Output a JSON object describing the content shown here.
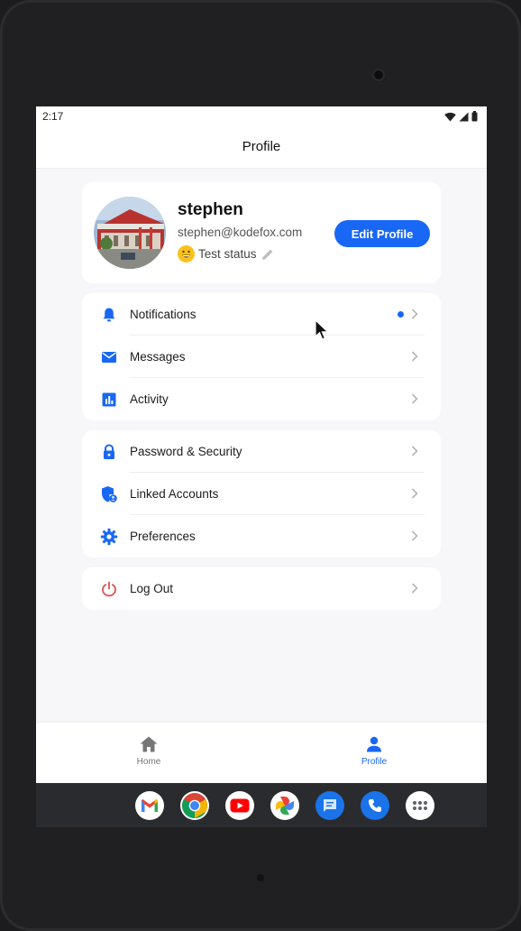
{
  "status_bar": {
    "time": "2:17"
  },
  "app_bar": {
    "title": "Profile"
  },
  "profile": {
    "username": "stephen",
    "email": "stephen@kodefox.com",
    "status_emoji": "grinning-face-icon",
    "status_text": "Test status",
    "edit_button_label": "Edit Profile"
  },
  "menu_groups": [
    {
      "items": [
        {
          "label": "Notifications",
          "icon": "bell-icon",
          "has_dot": true
        },
        {
          "label": "Messages",
          "icon": "mail-icon"
        },
        {
          "label": "Activity",
          "icon": "bar-chart-icon"
        }
      ]
    },
    {
      "items": [
        {
          "label": "Password & Security",
          "icon": "lock-icon"
        },
        {
          "label": "Linked Accounts",
          "icon": "shield-account-icon"
        },
        {
          "label": "Preferences",
          "icon": "gear-icon"
        }
      ]
    },
    {
      "items": [
        {
          "label": "Log Out",
          "icon": "power-icon"
        }
      ]
    }
  ],
  "bottom_nav": {
    "items": [
      {
        "label": "Home",
        "icon": "home-icon",
        "active": false
      },
      {
        "label": "Profile",
        "icon": "person-icon",
        "active": true
      }
    ]
  },
  "dock": {
    "apps": [
      "gmail-icon",
      "chrome-icon",
      "youtube-icon",
      "photos-icon",
      "messages-icon",
      "phone-icon",
      "app-drawer-icon"
    ]
  },
  "colors": {
    "accent": "#1868f5",
    "logout_icon": "#d9534f",
    "inactive_nav": "#777777"
  }
}
